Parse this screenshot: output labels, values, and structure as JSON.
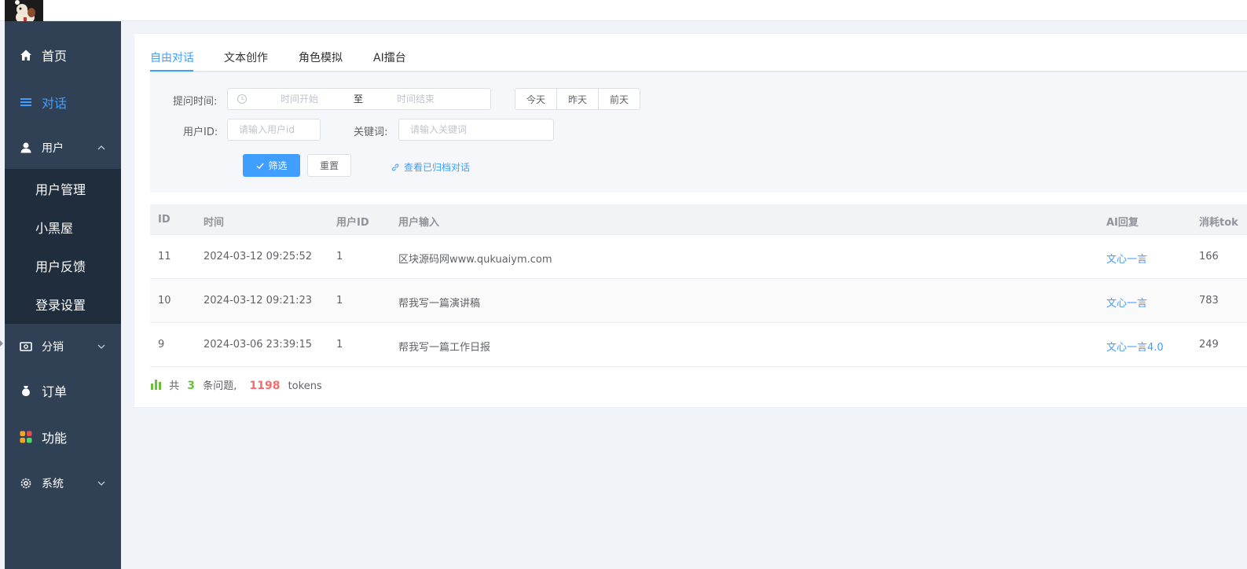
{
  "sidebar": {
    "home": "首页",
    "dialog": "对话",
    "user": "用户",
    "user_sub": [
      "用户管理",
      "小黑屋",
      "用户反馈",
      "登录设置"
    ],
    "distribution": "分销",
    "orders": "订单",
    "features": "功能",
    "system": "系统"
  },
  "tabs": [
    "自由对话",
    "文本创作",
    "角色模拟",
    "AI擂台"
  ],
  "filters": {
    "time_label": "提问时间:",
    "time_start": "时间开始",
    "time_sep": "至",
    "time_end": "时间结束",
    "quick_days": [
      "今天",
      "昨天",
      "前天"
    ],
    "userid_label": "用户ID:",
    "userid_placeholder": "请输入用户id",
    "keyword_label": "关键词:",
    "keyword_placeholder": "请输入关键词",
    "filter_button": "筛选",
    "reset_button": "重置",
    "archived_link": "查看已归档对话"
  },
  "table": {
    "headers": [
      "ID",
      "时间",
      "用户ID",
      "用户输入",
      "AI回复",
      "消耗tok"
    ],
    "rows": [
      {
        "id": "11",
        "time": "2024-03-12 09:25:52",
        "user_id": "1",
        "input": "区块源码网www.qukuaiym.com",
        "ai": "文心一言",
        "tokens": "166"
      },
      {
        "id": "10",
        "time": "2024-03-12 09:21:23",
        "user_id": "1",
        "input": "帮我写一篇演讲稿",
        "ai": "文心一言",
        "tokens": "783"
      },
      {
        "id": "9",
        "time": "2024-03-06 23:39:15",
        "user_id": "1",
        "input": "帮我写一篇工作日报",
        "ai": "文心一言4.0",
        "tokens": "249"
      }
    ]
  },
  "summary": {
    "prefix": "共",
    "count": "3",
    "mid": "条问题,",
    "tokens": "1198",
    "suffix": "tokens"
  },
  "colors": {
    "sidebar_bg": "#304156",
    "submenu_bg": "#1f2d3d",
    "accent": "#409eff",
    "green": "#67c23a",
    "red": "#f56c6c"
  }
}
